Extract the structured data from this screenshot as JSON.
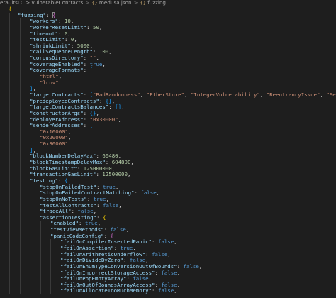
{
  "breadcrumb": {
    "folder": "eraultsLC > vulnerableContracts",
    "file": "medusa.json",
    "symbol": "fuzzing",
    "file_icon": "json-braces-icon",
    "symbol_icon": "object-braces-icon"
  },
  "colors": {
    "background": "#1e1e1e",
    "key": "#9cdcfe",
    "string": "#ce9178",
    "number": "#b5cea8",
    "boolean": "#569cd6",
    "punctuation": "#d4d4d4",
    "bracket_level1": "#ffd700",
    "bracket_level2": "#da70d6",
    "bracket_level3": "#179fff"
  },
  "code_lines": [
    [
      [
        "br1",
        "{"
      ]
    ],
    [
      [
        "k",
        "\"fuzzing\""
      ],
      [
        "p",
        ": "
      ],
      [
        "br2",
        "{"
      ]
    ],
    [
      [
        "k",
        "\"workers\""
      ],
      [
        "p",
        ": "
      ],
      [
        "n",
        "10"
      ],
      [
        "p",
        ","
      ]
    ],
    [
      [
        "k",
        "\"workerResetLimit\""
      ],
      [
        "p",
        ": "
      ],
      [
        "n",
        "50"
      ],
      [
        "p",
        ","
      ]
    ],
    [
      [
        "k",
        "\"timeout\""
      ],
      [
        "p",
        ": "
      ],
      [
        "n",
        "0"
      ],
      [
        "p",
        ","
      ]
    ],
    [
      [
        "k",
        "\"testLimit\""
      ],
      [
        "p",
        ": "
      ],
      [
        "n",
        "0"
      ],
      [
        "p",
        ","
      ]
    ],
    [
      [
        "k",
        "\"shrinkLimit\""
      ],
      [
        "p",
        ": "
      ],
      [
        "n",
        "5000"
      ],
      [
        "p",
        ","
      ]
    ],
    [
      [
        "k",
        "\"callSequenceLength\""
      ],
      [
        "p",
        ": "
      ],
      [
        "n",
        "100"
      ],
      [
        "p",
        ","
      ]
    ],
    [
      [
        "k",
        "\"corpusDirectory\""
      ],
      [
        "p",
        ": "
      ],
      [
        "s",
        "\"\""
      ],
      [
        "p",
        ","
      ]
    ],
    [
      [
        "k",
        "\"coverageEnabled\""
      ],
      [
        "p",
        ": "
      ],
      [
        "b",
        "true"
      ],
      [
        "p",
        ","
      ]
    ],
    [
      [
        "k",
        "\"coverageFormats\""
      ],
      [
        "p",
        ": "
      ],
      [
        "br3",
        "["
      ]
    ],
    [
      [
        "s",
        "\"html\""
      ],
      [
        "p",
        ","
      ]
    ],
    [
      [
        "s",
        "\"lcov\""
      ]
    ],
    [
      [
        "br3",
        "]"
      ],
      [
        "p",
        ","
      ]
    ],
    [
      [
        "k",
        "\"targetContracts\""
      ],
      [
        "p",
        ": "
      ],
      [
        "br3",
        "["
      ],
      [
        "s",
        "\"BadRandomness\""
      ],
      [
        "p",
        ", "
      ],
      [
        "s",
        "\"EtherStore\""
      ],
      [
        "p",
        ", "
      ],
      [
        "s",
        "\"IntegerVulnerability\""
      ],
      [
        "p",
        ", "
      ],
      [
        "s",
        "\"ReentrancyIssue\""
      ],
      [
        "p",
        ", "
      ],
      [
        "s",
        "\"SelfDestrcut\""
      ],
      [
        "br3",
        "]"
      ],
      [
        "p",
        ","
      ]
    ],
    [
      [
        "k",
        "\"predeployedContracts\""
      ],
      [
        "p",
        ": "
      ],
      [
        "br3",
        "{}"
      ],
      [
        "p",
        ","
      ]
    ],
    [
      [
        "k",
        "\"targetContractsBalances\""
      ],
      [
        "p",
        ": "
      ],
      [
        "br3",
        "[]"
      ],
      [
        "p",
        ","
      ]
    ],
    [
      [
        "k",
        "\"constructorArgs\""
      ],
      [
        "p",
        ": "
      ],
      [
        "br3",
        "{}"
      ],
      [
        "p",
        ","
      ]
    ],
    [
      [
        "k",
        "\"deployerAddress\""
      ],
      [
        "p",
        ": "
      ],
      [
        "s",
        "\"0x30000\""
      ],
      [
        "p",
        ","
      ]
    ],
    [
      [
        "k",
        "\"senderAddresses\""
      ],
      [
        "p",
        ": "
      ],
      [
        "br3",
        "["
      ]
    ],
    [
      [
        "s",
        "\"0x10000\""
      ],
      [
        "p",
        ","
      ]
    ],
    [
      [
        "s",
        "\"0x20000\""
      ],
      [
        "p",
        ","
      ]
    ],
    [
      [
        "s",
        "\"0x30000\""
      ]
    ],
    [
      [
        "br3",
        "]"
      ],
      [
        "p",
        ","
      ]
    ],
    [
      [
        "k",
        "\"blockNumberDelayMax\""
      ],
      [
        "p",
        ": "
      ],
      [
        "n",
        "60480"
      ],
      [
        "p",
        ","
      ]
    ],
    [
      [
        "k",
        "\"blockTimestampDelayMax\""
      ],
      [
        "p",
        ": "
      ],
      [
        "n",
        "604800"
      ],
      [
        "p",
        ","
      ]
    ],
    [
      [
        "k",
        "\"blockGasLimit\""
      ],
      [
        "p",
        ": "
      ],
      [
        "n",
        "125000000"
      ],
      [
        "p",
        ","
      ]
    ],
    [
      [
        "k",
        "\"transactionGasLimit\""
      ],
      [
        "p",
        ": "
      ],
      [
        "n",
        "12500000"
      ],
      [
        "p",
        ","
      ]
    ],
    [
      [
        "k",
        "\"testing\""
      ],
      [
        "p",
        ": "
      ],
      [
        "br3",
        "{"
      ]
    ],
    [
      [
        "k",
        "\"stopOnFailedTest\""
      ],
      [
        "p",
        ": "
      ],
      [
        "b",
        "true"
      ],
      [
        "p",
        ","
      ]
    ],
    [
      [
        "k",
        "\"stopOnFailedContractMatching\""
      ],
      [
        "p",
        ": "
      ],
      [
        "b",
        "false"
      ],
      [
        "p",
        ","
      ]
    ],
    [
      [
        "k",
        "\"stopOnNoTests\""
      ],
      [
        "p",
        ": "
      ],
      [
        "b",
        "true"
      ],
      [
        "p",
        ","
      ]
    ],
    [
      [
        "k",
        "\"testAllContracts\""
      ],
      [
        "p",
        ": "
      ],
      [
        "b",
        "false"
      ],
      [
        "p",
        ","
      ]
    ],
    [
      [
        "k",
        "\"traceAll\""
      ],
      [
        "p",
        ": "
      ],
      [
        "b",
        "false"
      ],
      [
        "p",
        ","
      ]
    ],
    [
      [
        "k",
        "\"assertionTesting\""
      ],
      [
        "p",
        ": "
      ],
      [
        "br1",
        "{"
      ]
    ],
    [
      [
        "k",
        "\"enabled\""
      ],
      [
        "p",
        ": "
      ],
      [
        "b",
        "true"
      ],
      [
        "p",
        ","
      ]
    ],
    [
      [
        "k",
        "\"testViewMethods\""
      ],
      [
        "p",
        ": "
      ],
      [
        "b",
        "false"
      ],
      [
        "p",
        ","
      ]
    ],
    [
      [
        "k",
        "\"panicCodeConfig\""
      ],
      [
        "p",
        ": "
      ],
      [
        "br2",
        "{"
      ]
    ],
    [
      [
        "k",
        "\"failOnCompilerInsertedPanic\""
      ],
      [
        "p",
        ": "
      ],
      [
        "b",
        "false"
      ],
      [
        "p",
        ","
      ]
    ],
    [
      [
        "k",
        "\"failOnAssertion\""
      ],
      [
        "p",
        ": "
      ],
      [
        "b",
        "true"
      ],
      [
        "p",
        ","
      ]
    ],
    [
      [
        "k",
        "\"failOnArithmeticUnderflow\""
      ],
      [
        "p",
        ": "
      ],
      [
        "b",
        "false"
      ],
      [
        "p",
        ","
      ]
    ],
    [
      [
        "k",
        "\"failOnDivideByZero\""
      ],
      [
        "p",
        ": "
      ],
      [
        "b",
        "false"
      ],
      [
        "p",
        ","
      ]
    ],
    [
      [
        "k",
        "\"failOnEnumTypeConversionOutOfBounds\""
      ],
      [
        "p",
        ": "
      ],
      [
        "b",
        "false"
      ],
      [
        "p",
        ","
      ]
    ],
    [
      [
        "k",
        "\"failOnIncorrectStorageAccess\""
      ],
      [
        "p",
        ": "
      ],
      [
        "b",
        "false"
      ],
      [
        "p",
        ","
      ]
    ],
    [
      [
        "k",
        "\"failOnPopEmptyArray\""
      ],
      [
        "p",
        ": "
      ],
      [
        "b",
        "false"
      ],
      [
        "p",
        ","
      ]
    ],
    [
      [
        "k",
        "\"failOnOutOfBoundsArrayAccess\""
      ],
      [
        "p",
        ": "
      ],
      [
        "b",
        "false"
      ],
      [
        "p",
        ","
      ]
    ],
    [
      [
        "k",
        "\"failOnAllocateTooMuchMemory\""
      ],
      [
        "p",
        ": "
      ],
      [
        "b",
        "false"
      ],
      [
        "p",
        ","
      ]
    ]
  ]
}
